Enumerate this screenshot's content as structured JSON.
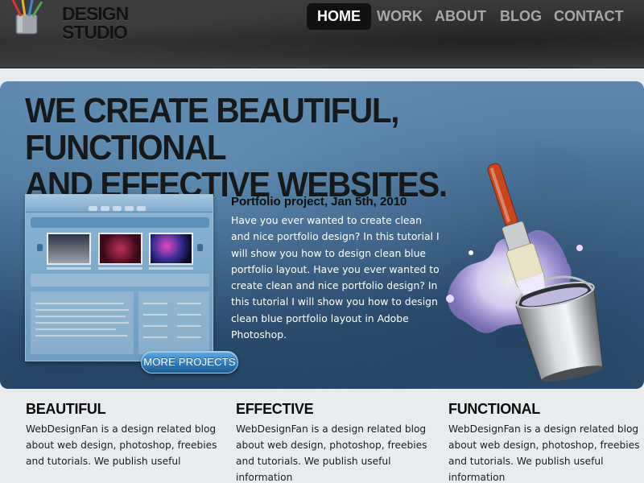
{
  "header": {
    "logo_line1": "DESIGN",
    "logo_line2": "STUDIO",
    "logo_icon": "brush-cup-icon",
    "nav": [
      {
        "label": "HOME",
        "active": true
      },
      {
        "label": "WORK",
        "active": false
      },
      {
        "label": "ABOUT",
        "active": false
      },
      {
        "label": "BLOG",
        "active": false
      },
      {
        "label": "CONTACT",
        "active": false
      }
    ]
  },
  "hero": {
    "heading_line1": "WE CREATE BEAUTIFUL, FUNCTIONAL",
    "heading_line2": "AND EFFECTIVE WEBSITES.",
    "project_title": "Portfolio project, Jan 5th, 2010",
    "project_text": "Have you ever wanted to create clean and nice portfolio design? In this tutorial I will show you how to design clean blue portfolio layout. Have you ever wanted to create clean and nice portfolio design? In this tutorial I will show you how to design clean blue portfolio layout in Adobe Photoshop.",
    "more_button": "MORE PROJECTS",
    "illustration_icon": "paintbrush-bucket-icon"
  },
  "features": [
    {
      "title": "BEAUTIFUL",
      "text": "WebDesignFan is a design related blog about web design, photoshop, freebies and tutorials. We publish useful"
    },
    {
      "title": "EFFECTIVE",
      "text": "WebDesignFan is a design related blog about web design, photoshop, freebies and tutorials. We publish useful information"
    },
    {
      "title": "FUNCTIONAL",
      "text": "WebDesignFan is a design related blog about web design, photoshop, freebies and tutorials. We publish useful information"
    }
  ],
  "colors": {
    "header_bg": "#2f2f31",
    "hero_bg": "#4a7499",
    "button_blue": "#2e79b8",
    "nav_inactive": "#a7a7a7"
  }
}
